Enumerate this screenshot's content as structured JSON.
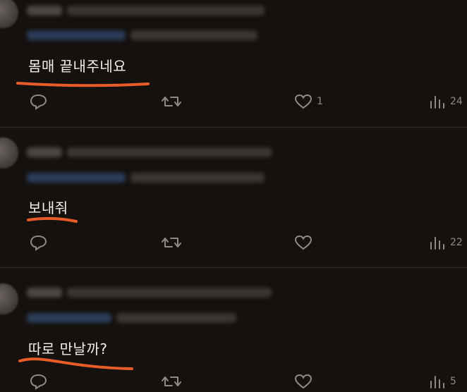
{
  "accent_color": "#e85c2a",
  "tweets": [
    {
      "text": "몸매 끝내주네요",
      "likes": "1",
      "views": "24",
      "icons": [
        "reply-icon",
        "retweet-icon",
        "like-icon",
        "views-icon"
      ]
    },
    {
      "text": "보내줘",
      "likes": "",
      "views": "22",
      "icons": [
        "reply-icon",
        "retweet-icon",
        "like-icon",
        "views-icon"
      ]
    },
    {
      "text": "따로 만날까?",
      "likes": "",
      "views": "5",
      "icons": [
        "reply-icon",
        "retweet-icon",
        "like-icon",
        "views-icon"
      ]
    }
  ]
}
